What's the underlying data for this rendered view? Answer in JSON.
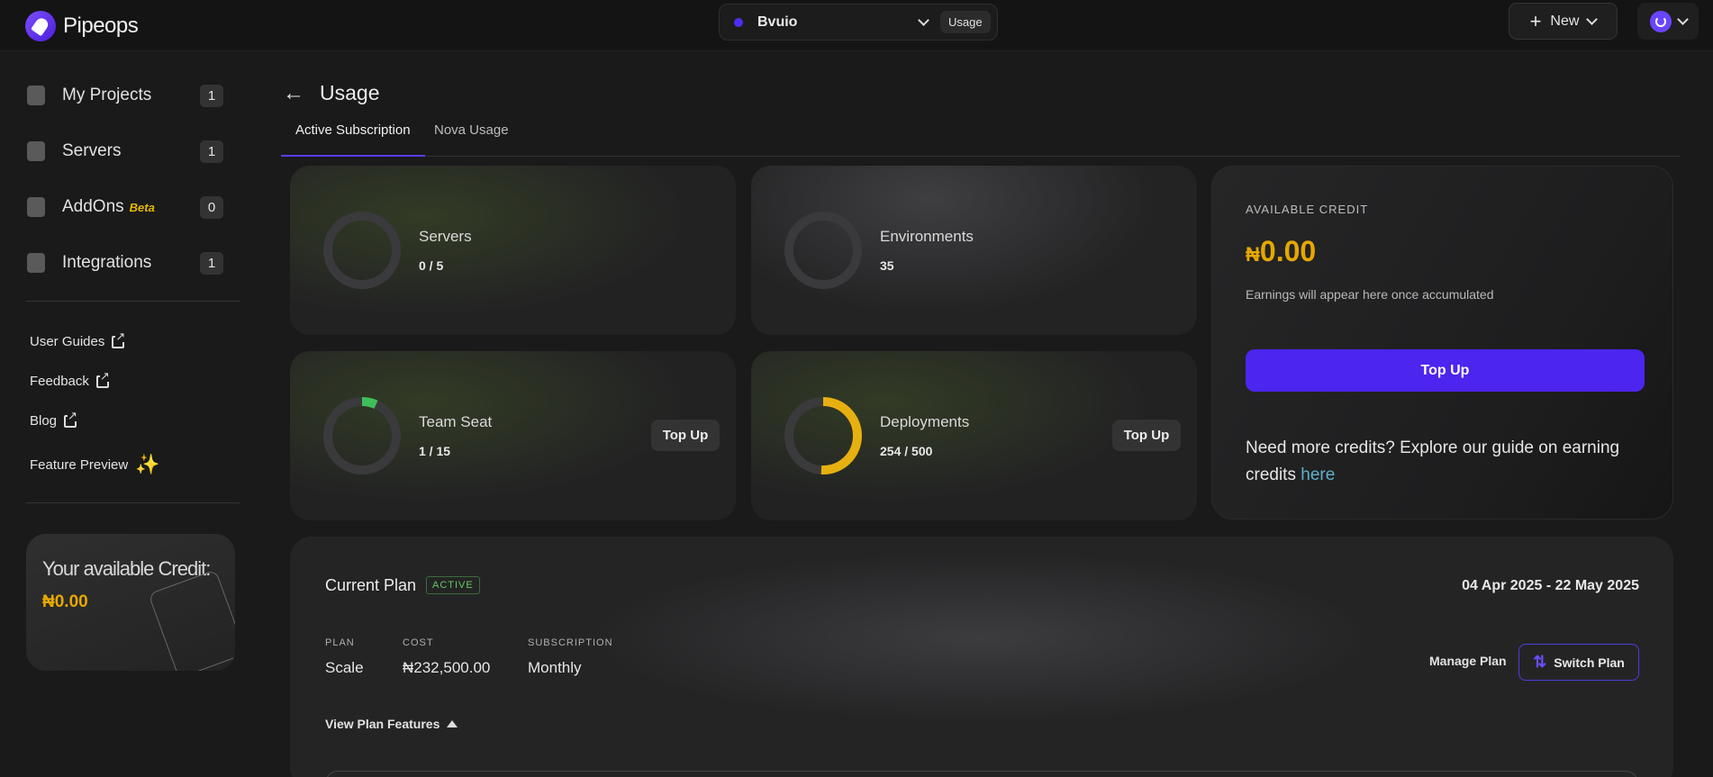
{
  "app": {
    "name": "Pipeops"
  },
  "topbar": {
    "project_name": "Bvuio",
    "section_pill": "Usage",
    "new_label": "New",
    "colors": {
      "project_dot": "#4c2ef0",
      "avatar": "#6a45ff"
    }
  },
  "sidebar": {
    "items": [
      {
        "label": "My Projects",
        "count": "1",
        "icon": "file-icon"
      },
      {
        "label": "Servers",
        "count": "1",
        "icon": "server-icon"
      },
      {
        "label": "AddOns",
        "badge": "Beta",
        "count": "0",
        "icon": "plug-icon"
      },
      {
        "label": "Integrations",
        "count": "1",
        "icon": "puzzle-icon"
      }
    ],
    "links": [
      {
        "label": "User Guides",
        "icon": "external-link-icon"
      },
      {
        "label": "Feedback",
        "icon": "external-link-icon"
      },
      {
        "label": "Blog",
        "icon": "external-link-icon"
      },
      {
        "label": "Feature Preview",
        "icon": "sparkle-icon"
      }
    ],
    "credit_card": {
      "title": "Your available Credit:",
      "value": "₦0.00"
    }
  },
  "page": {
    "title": "Usage",
    "tabs": [
      {
        "label": "Active Subscription",
        "active": true
      },
      {
        "label": "Nova Usage",
        "active": false
      }
    ]
  },
  "stats": {
    "servers": {
      "label": "Servers",
      "value": "0 / 5",
      "fraction": 0.0
    },
    "environments": {
      "label": "Environments",
      "value": "35",
      "fraction": 0.0
    },
    "team_seat": {
      "label": "Team Seat",
      "value": "1 / 15",
      "fraction": 0.0667,
      "button": "Top Up",
      "color": "#3fbf5a"
    },
    "deployments": {
      "label": "Deployments",
      "value": "254 / 500",
      "fraction": 0.508,
      "button": "Top Up",
      "color": "#e6b010"
    }
  },
  "credit": {
    "label": "AVAILABLE CREDIT",
    "currency": "₦",
    "amount": "0.00",
    "note": "Earnings will appear here once accumulated",
    "topup_label": "Top Up",
    "guide_text": "Need more credits? Explore our guide on earning credits ",
    "guide_link": "here"
  },
  "plan": {
    "title": "Current Plan",
    "status": "ACTIVE",
    "dates": "04 Apr 2025 - 22 May 2025",
    "plan_label": "PLAN",
    "plan_value": "Scale",
    "cost_label": "COST",
    "cost_value": "₦232,500.00",
    "subscription_label": "SUBSCRIPTION",
    "subscription_value": "Monthly",
    "view_features": "View Plan Features",
    "manage_label": "Manage Plan",
    "switch_label": "Switch Plan"
  }
}
